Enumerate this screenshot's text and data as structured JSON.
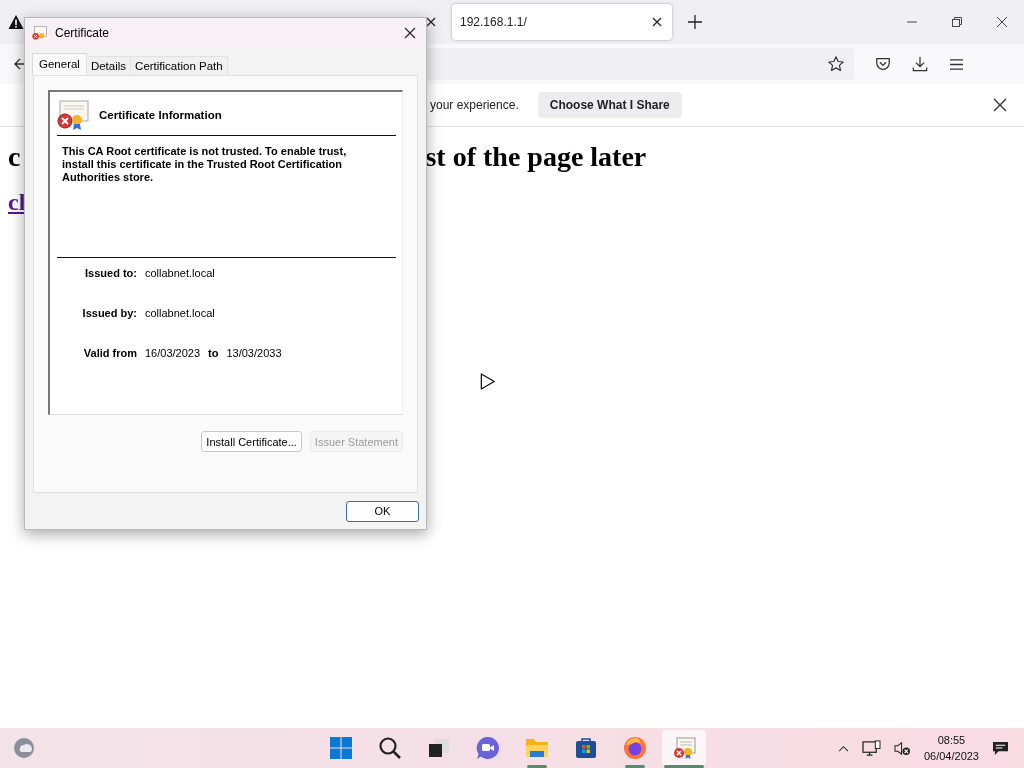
{
  "browser": {
    "tabs": [
      {
        "selected": false,
        "warning": true
      },
      {
        "title": "192.168.1.1/",
        "selected": true,
        "warning": false
      }
    ],
    "notification": {
      "message": "your experience.",
      "button": "Choose What I Share"
    }
  },
  "page": {
    "heading_parts": [
      "c",
      "st of the page later"
    ],
    "link": "cl"
  },
  "dialog": {
    "title": "Certificate",
    "tabs": [
      {
        "label": "General",
        "selected": true
      },
      {
        "label": "Details",
        "selected": false
      },
      {
        "label": "Certification Path",
        "selected": false
      }
    ],
    "heading": "Certificate Information",
    "warning": "This CA Root certificate is not trusted. To enable trust, install this certificate in the Trusted Root Certification Authorities store.",
    "fields": [
      {
        "label": "Issued to:",
        "value": "collabnet.local"
      },
      {
        "label": "Issued by:",
        "value": "collabnet.local"
      }
    ],
    "valid": {
      "label": "Valid from",
      "from": "16/03/2023",
      "to_label": "to",
      "to": "13/03/2033"
    },
    "buttons": [
      {
        "label": "Install Certificate...",
        "disabled": false
      },
      {
        "label": "Issuer Statement",
        "disabled": true
      }
    ],
    "ok": "OK"
  },
  "taskbar": {
    "apps": [
      {
        "kind": "start",
        "running": false,
        "selected": false
      },
      {
        "kind": "search",
        "running": false,
        "selected": false
      },
      {
        "kind": "taskview",
        "running": false,
        "selected": false
      },
      {
        "kind": "chat",
        "running": false,
        "selected": false
      },
      {
        "kind": "explorer",
        "running": true,
        "selected": false
      },
      {
        "kind": "store",
        "running": false,
        "selected": false
      },
      {
        "kind": "firefox",
        "running": true,
        "selected": false
      },
      {
        "kind": "certificate",
        "running": true,
        "selected": true
      }
    ],
    "time": "08:55",
    "date": "06/04/2023"
  }
}
